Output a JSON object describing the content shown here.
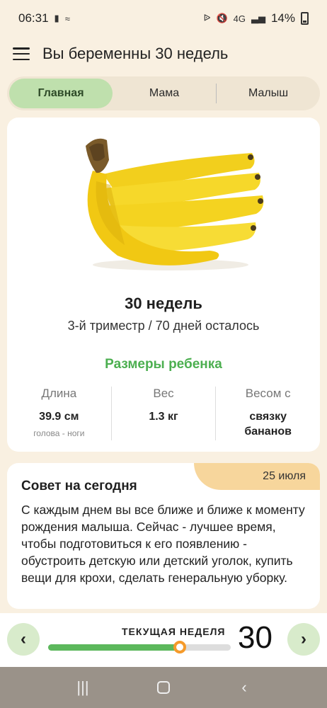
{
  "status_bar": {
    "time": "06:31",
    "battery": "14%",
    "network": "4G"
  },
  "header": {
    "title": "Вы беременны 30 недель"
  },
  "tabs": [
    {
      "label": "Главная",
      "active": true
    },
    {
      "label": "Мама",
      "active": false
    },
    {
      "label": "Малыш",
      "active": false
    }
  ],
  "main_card": {
    "image": "banana-bunch",
    "week_title": "30 недель",
    "subtitle": "3-й триместр / 70 дней осталось",
    "sizes_title": "Размеры ребенка",
    "stats": [
      {
        "label": "Длина",
        "value": "39.9 см",
        "note": "голова - ноги"
      },
      {
        "label": "Вес",
        "value": "1.3 кг",
        "note": ""
      },
      {
        "label": "Весом с",
        "value": "связку бананов",
        "note": ""
      }
    ]
  },
  "tip": {
    "date": "25 июля",
    "title": "Совет на сегодня",
    "text": "С каждым днем вы все ближе и ближе к моменту рождения малыша. Сейчас - лучшее время, чтобы подготовиться к его появлению - обустроить детскую или детский уголок, купить вещи для крохи, сделать генеральную уборку."
  },
  "week_bar": {
    "label": "ТЕКУЩАЯ НЕДЕЛЯ",
    "week": "30",
    "progress": 0.72,
    "prev_icon": "chevron-left-icon",
    "next_icon": "chevron-right-icon"
  },
  "colors": {
    "background": "#f9f0e1",
    "accent_green": "#4caf50",
    "tab_active": "#bfe0ad",
    "date_badge": "#f7d69c",
    "knob": "#f59a2a"
  }
}
